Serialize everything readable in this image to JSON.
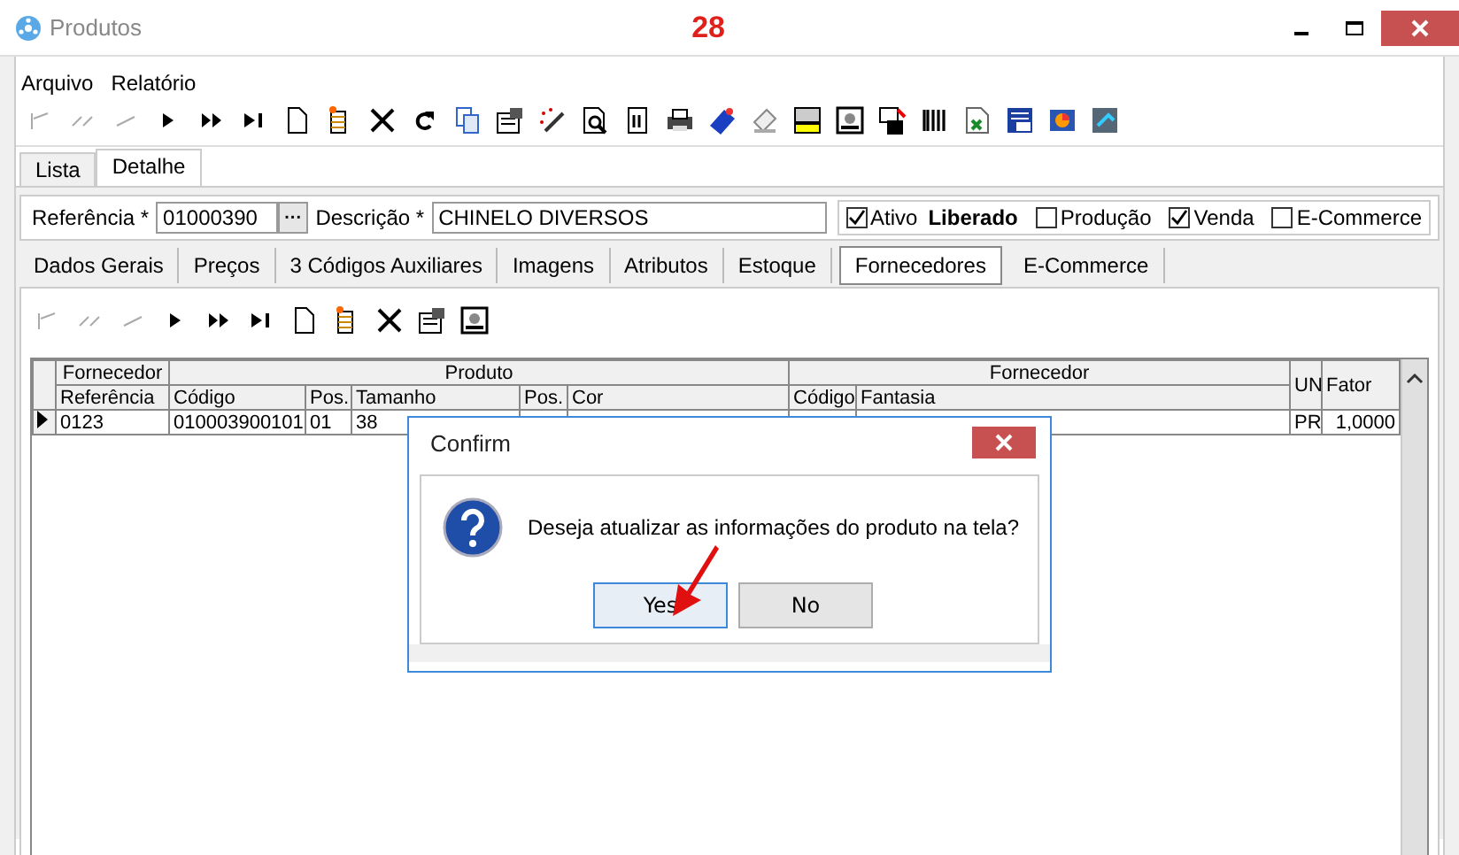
{
  "window": {
    "title": "Produtos",
    "annotation": "28"
  },
  "menu": [
    "Arquivo",
    "Relatório"
  ],
  "tabs": [
    {
      "label": "Lista",
      "selected": false
    },
    {
      "label": "Detalhe",
      "selected": true
    }
  ],
  "form": {
    "referencia_label": "Referência *",
    "referencia": "01000390",
    "browse": "···",
    "descricao_label": "Descrição *",
    "descricao": "CHINELO DIVERSOS",
    "status": "Liberado",
    "checks": [
      {
        "label": "Ativo",
        "checked": true
      },
      {
        "label": "Produção",
        "checked": false
      },
      {
        "label": "Venda",
        "checked": true
      },
      {
        "label": "E-Commerce",
        "checked": false
      }
    ]
  },
  "subtabs": [
    {
      "label": "Dados Gerais",
      "selected": false
    },
    {
      "label": "Preços",
      "selected": false
    },
    {
      "label": "3 Códigos Auxiliares",
      "selected": false
    },
    {
      "label": "Imagens",
      "selected": false
    },
    {
      "label": "Atributos",
      "selected": false
    },
    {
      "label": "Estoque",
      "selected": false
    },
    {
      "label": "Fornecedores",
      "selected": true
    },
    {
      "label": "E-Commerce",
      "selected": false
    }
  ],
  "grid": {
    "groups": [
      "Fornecedor",
      "Produto",
      "Fornecedor"
    ],
    "tall_columns": [
      "UN",
      "Fator"
    ],
    "columns": [
      "Referência",
      "Código",
      "Pos.",
      "Tamanho",
      "Pos.",
      "Cor",
      "Código",
      "Fantasia"
    ],
    "rows": [
      {
        "current": true,
        "left_cells": [
          "0123",
          "010003900101",
          "01",
          "38"
        ],
        "right_cells": [
          "PR",
          "1,0000"
        ]
      }
    ]
  },
  "dialog": {
    "title": "Confirm",
    "message": "Deseja atualizar as informações do produto na tela?",
    "buttons": [
      {
        "label": "Yes",
        "selected": true
      },
      {
        "label": "No",
        "selected": false
      }
    ]
  }
}
